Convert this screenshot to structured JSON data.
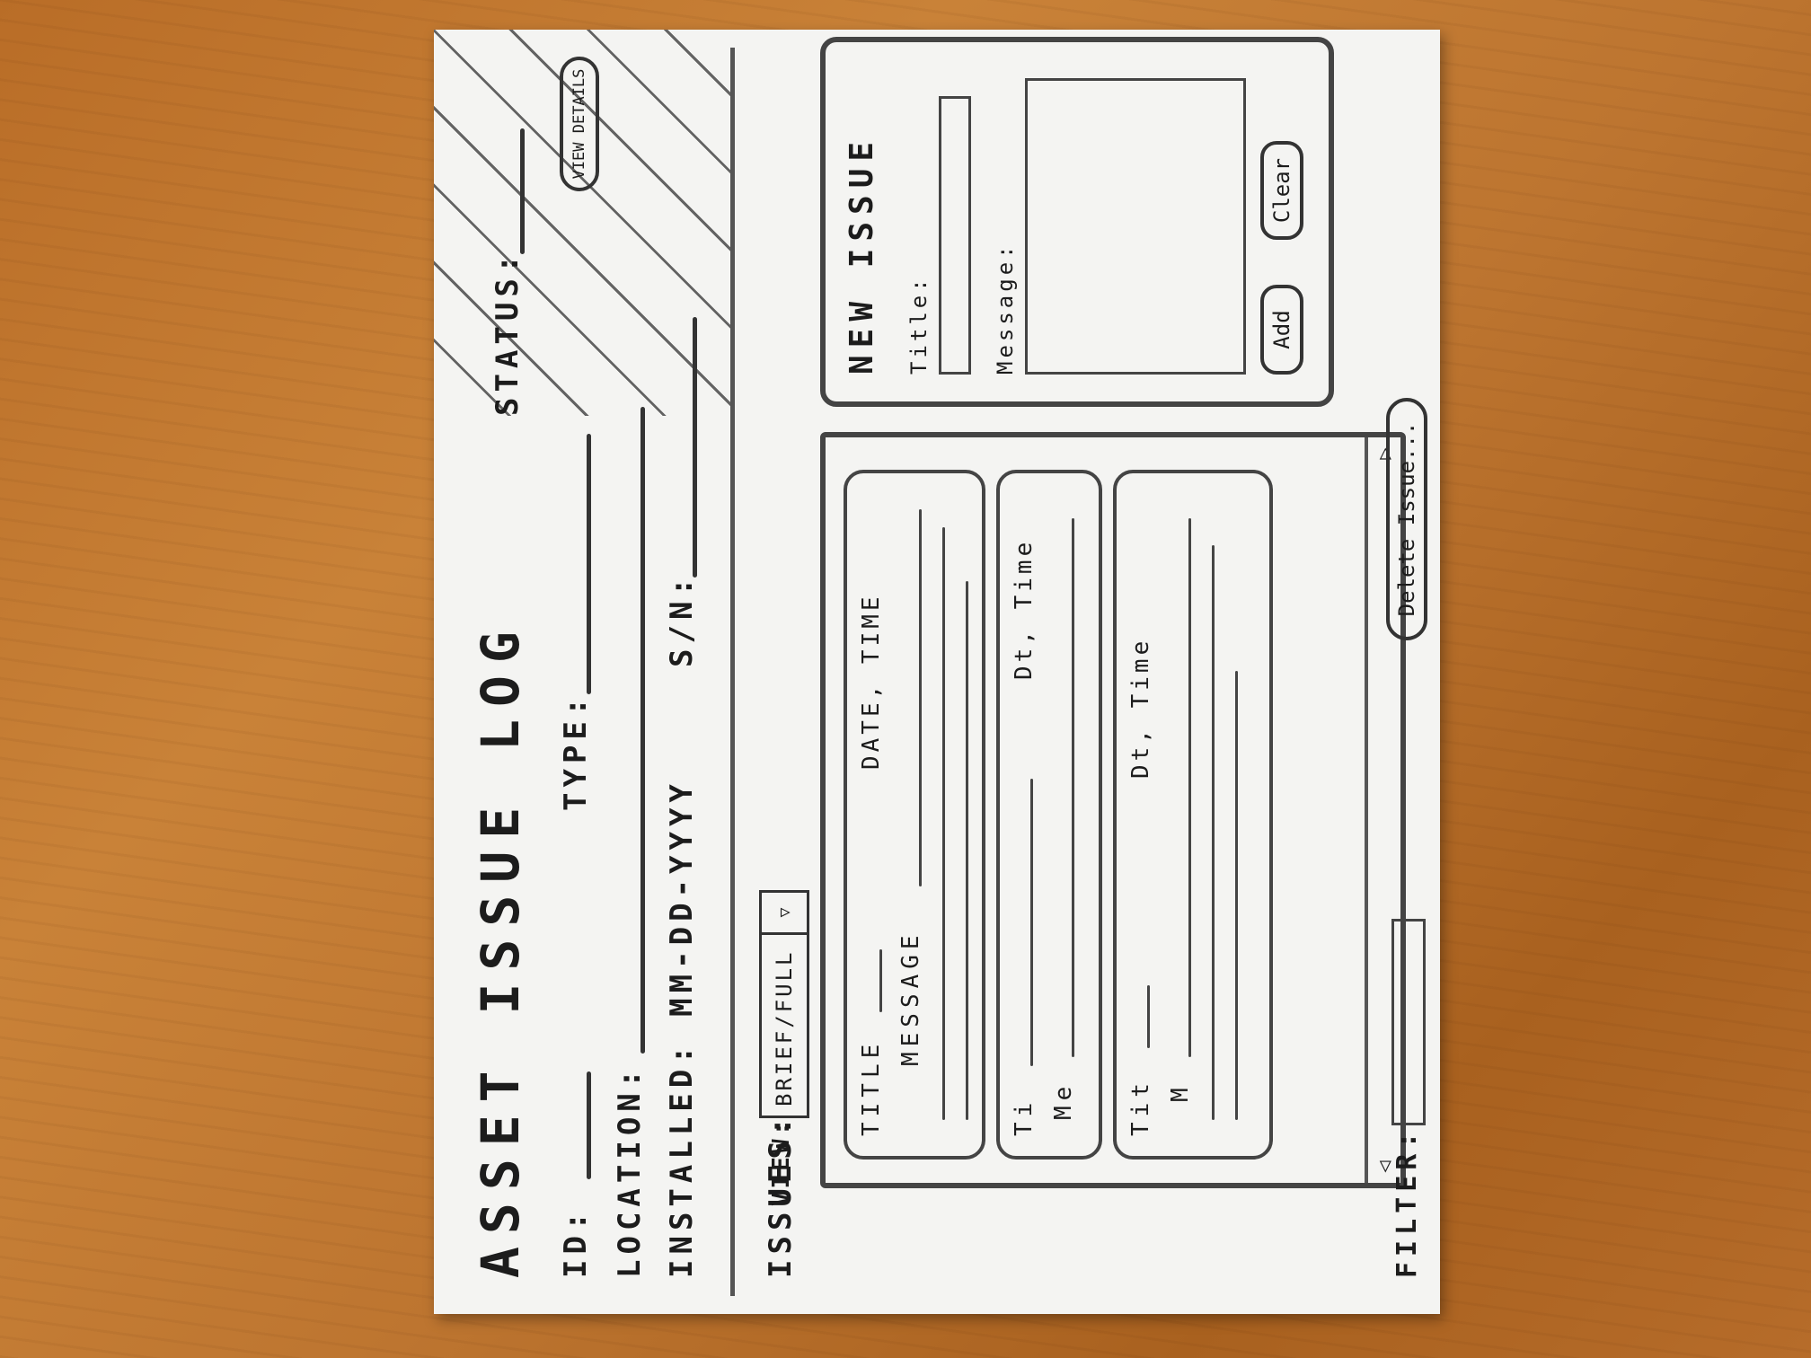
{
  "header": {
    "title": "ASSET ISSUE LOG",
    "status_label": "STATUS:",
    "view_details_label": "VIEW DETAILS"
  },
  "fields": {
    "id_label": "ID:",
    "type_label": "TYPE:",
    "location_label": "LOCATION:",
    "installed_label": "INSTALLED:",
    "installed_value": "MM-DD-YYYY",
    "sn_label": "S/N:"
  },
  "issues": {
    "label": "ISSUES:",
    "view_label": "VIEW:",
    "view_selected": "BRIEF/FULL",
    "cards": [
      {
        "title": "TITLE",
        "datetime": "DATE, TIME",
        "message": "MESSAGE"
      },
      {
        "title": "Ti",
        "datetime": "Dt, Time",
        "message": "Me"
      },
      {
        "title": "Tit",
        "datetime": "Dt, Time",
        "message": "M"
      }
    ],
    "delete_label": "Delete Issue..."
  },
  "new_issue": {
    "title": "NEW ISSUE",
    "title_label": "Title:",
    "message_label": "Message:",
    "add_label": "Add",
    "clear_label": "Clear"
  },
  "filter": {
    "label": "FILTER:"
  },
  "colors": {
    "wood": "#c07a33",
    "paper": "#f4f4f2",
    "ink": "#1c1c1c"
  }
}
